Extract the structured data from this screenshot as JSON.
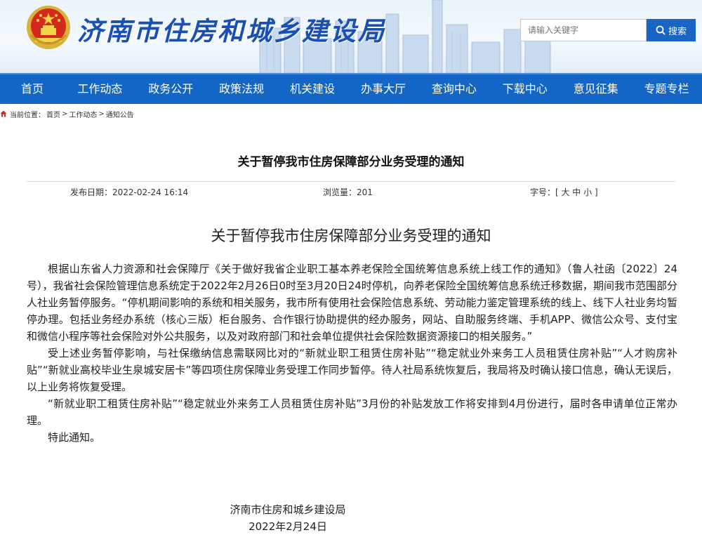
{
  "header": {
    "site_title": "济南市住房和城乡建设局",
    "search_placeholder": "请输入关键字",
    "search_button": "搜索"
  },
  "nav": {
    "items": [
      "首页",
      "工作动态",
      "政务公开",
      "政策法规",
      "机关建设",
      "办事大厅",
      "查询中心",
      "下载中心",
      "意见征集",
      "专题专栏"
    ]
  },
  "breadcrumb": {
    "label": "当前位置：",
    "items": [
      "首页",
      "工作动态",
      "通知公告"
    ]
  },
  "article": {
    "title": "关于暂停我市住房保障部分业务受理的通知",
    "meta": {
      "date": "发布日期：2022-02-24 16:14",
      "views": "浏览量：201",
      "font_size": "字号：[ 大 中 小 ]"
    },
    "heading": "关于暂停我市住房保障部分业务受理的通知",
    "paragraphs": [
      "根据山东省人力资源和社会保障厅《关于做好我省企业职工基本养老保险全国统筹信息系统上线工作的通知》（鲁人社函〔2022〕24号），我省社会保险管理信息系统定于2022年2月26日0时至3月20日24时停机，向养老保险全国统筹信息系统迁移数据，期间我市范围部分人社业务暂停服务。“停机期间影响的系统和相关服务，我市所有使用社会保险信息系统、劳动能力鉴定管理系统的线上、线下人社业务均暂停办理。包括业务经办系统（核心三版）柜台服务、合作银行协助提供的经办服务，网站、自助服务终端、手机APP、微信公众号、支付宝和微信小程序等社会保险对外公共服务，以及对政府部门和社会单位提供社会保险数据资源接口的相关服务。”",
      "受上述业务暂停影响，与社保缴纳信息需联网比对的“新就业职工租赁住房补贴”“稳定就业外来务工人员租赁住房补贴”“人才购房补贴”“新就业高校毕业生泉城安居卡”等四项住房保障业务受理工作同步暂停。待人社局系统恢复后，我局将及时确认接口信息，确认无误后，以上业务将恢复受理。",
      "“新就业职工租赁住房补贴”“稳定就业外来务工人员租赁住房补贴”3月份的补贴发放工作将安排到4月份进行，届时各申请单位正常办理。",
      "特此通知。"
    ],
    "signature": {
      "org": "济南市住房和城乡建设局",
      "date": "2022年2月24日"
    }
  },
  "colors": {
    "nav_bg": "#1466c6",
    "title_blue": "#1a4fb4",
    "search_btn": "#1a65c4"
  },
  "icons": [
    "national-emblem-icon",
    "search-icon",
    "home-icon"
  ]
}
